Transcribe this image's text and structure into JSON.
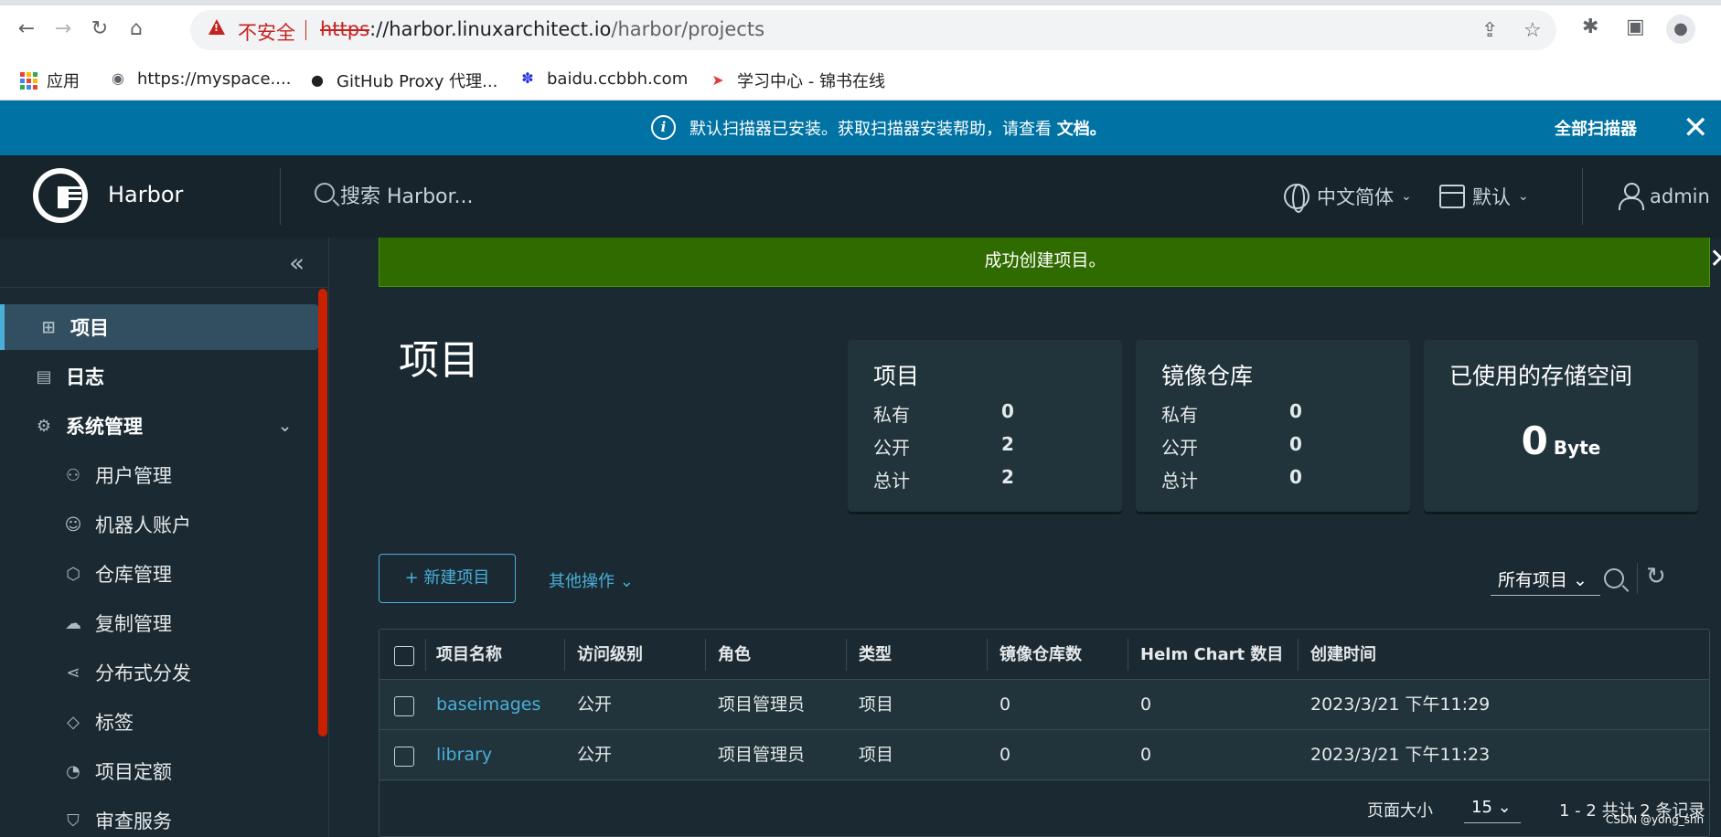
{
  "browser": {
    "insecure_label": "不安全",
    "url_scheme": "https",
    "url_host": "://harbor.linuxarchitect.io",
    "url_path": "/harbor/projects",
    "bookmarks": [
      {
        "label": "应用",
        "icon": "apps-grid-icon"
      },
      {
        "label": "https://myspace....",
        "icon": "globe-icon"
      },
      {
        "label": "GitHub Proxy 代理...",
        "icon": "github-icon"
      },
      {
        "label": "baidu.ccbbh.com",
        "icon": "baidu-paw-icon"
      },
      {
        "label": "学习中心 - 锦书在线",
        "icon": "jinshu-icon"
      }
    ]
  },
  "banner": {
    "text": "默认扫描器已安装。获取扫描器安装帮助，请查看",
    "link": "文档。",
    "action": "全部扫描器",
    "close": "✕"
  },
  "header": {
    "brand": "Harbor",
    "search_placeholder": "搜索 Harbor...",
    "language": "中文简体",
    "datetime": "默认",
    "user": "admin"
  },
  "sidebar": {
    "collapse": "«",
    "items": [
      {
        "label": "项目",
        "icon": "project-tree-icon"
      },
      {
        "label": "日志",
        "icon": "log-icon"
      },
      {
        "label": "系统管理",
        "icon": "admin-gear-icon"
      },
      {
        "label": "用户管理",
        "icon": "users-icon"
      },
      {
        "label": "机器人账户",
        "icon": "robot-icon"
      },
      {
        "label": "仓库管理",
        "icon": "cube-icon"
      },
      {
        "label": "复制管理",
        "icon": "cloud-sync-icon"
      },
      {
        "label": "分布式分发",
        "icon": "share-icon"
      },
      {
        "label": "标签",
        "icon": "tag-icon"
      },
      {
        "label": "项目定额",
        "icon": "quota-icon"
      },
      {
        "label": "审查服务",
        "icon": "shield-icon"
      }
    ]
  },
  "toast": {
    "message": "成功创建项目。",
    "close": "✕"
  },
  "page": {
    "title": "项目"
  },
  "cards": {
    "projects": {
      "title": "项目",
      "rows": [
        {
          "label": "私有",
          "value": "0"
        },
        {
          "label": "公开",
          "value": "2"
        },
        {
          "label": "总计",
          "value": "2"
        }
      ]
    },
    "repos": {
      "title": "镜像仓库",
      "rows": [
        {
          "label": "私有",
          "value": "0"
        },
        {
          "label": "公开",
          "value": "0"
        },
        {
          "label": "总计",
          "value": "0"
        }
      ]
    },
    "storage": {
      "title": "已使用的存储空间",
      "value": "0",
      "unit": "Byte"
    }
  },
  "toolbar": {
    "new_project": "+ 新建项目",
    "more_actions": "其他操作 ⌄",
    "filter": "所有项目 ⌄"
  },
  "table": {
    "headers": [
      "项目名称",
      "访问级别",
      "角色",
      "类型",
      "镜像仓库数",
      "Helm Chart 数目",
      "创建时间"
    ],
    "rows": [
      [
        "baseimages",
        "公开",
        "项目管理员",
        "项目",
        "0",
        "0",
        "2023/3/21 下午11:29"
      ],
      [
        "library",
        "公开",
        "项目管理员",
        "项目",
        "0",
        "0",
        "2023/3/21 下午11:23"
      ]
    ],
    "page_size_label": "页面大小",
    "page_size": "15 ⌄",
    "total": "1 - 2 共计 2 条记录"
  },
  "watermark": "CSDN @yong_shh",
  "colors": {
    "banner": "#0072a3",
    "header": "#17242b",
    "success": "#306b00",
    "link": "#49afd9",
    "insecure": "#c5221f"
  }
}
